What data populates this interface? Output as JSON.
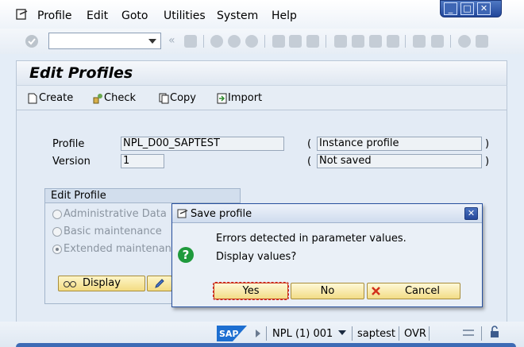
{
  "menu": {
    "items": [
      "Profile",
      "Edit",
      "Goto",
      "Utilities",
      "System",
      "Help"
    ],
    "underline": [
      "P",
      "E",
      "G",
      "U",
      "S",
      "H"
    ]
  },
  "window_controls": [
    "minimize",
    "maximize",
    "close"
  ],
  "toolbar": {
    "command_field_value": "",
    "icons": [
      "enter-icon",
      "save-icon",
      "back-icon",
      "exit-icon",
      "cancel-icon",
      "print-icon",
      "find-icon",
      "find-next-icon",
      "first-page-icon",
      "prev-page-icon",
      "next-page-icon",
      "last-page-icon",
      "new-session-icon",
      "shortcut-icon",
      "help-icon",
      "layout-icon"
    ]
  },
  "header": {
    "title": "Edit Profiles"
  },
  "app_toolbar": {
    "create": "Create",
    "check": "Check",
    "copy": "Copy",
    "import": "Import"
  },
  "form": {
    "profile_label": "Profile",
    "profile_value": "NPL_D00_SAPTEST",
    "profile_type": "Instance profile",
    "version_label": "Version",
    "version_value": "1",
    "version_status": "Not saved",
    "paren_open": "(",
    "paren_close": ")"
  },
  "group": {
    "title": "Edit Profile",
    "options": [
      "Administrative Data",
      "Basic maintenance",
      "Extended maintenance"
    ],
    "selected": "Extended maintenance",
    "display_button": "Display"
  },
  "dialog": {
    "title": "Save profile",
    "message_line1": "Errors detected in parameter values.",
    "message_line2": "Display values?",
    "yes": "Yes",
    "no": "No",
    "cancel": "Cancel"
  },
  "status": {
    "system": "NPL (1) 001",
    "user": "saptest",
    "mode": "OVR"
  },
  "colors": {
    "accent": "#2a55a5",
    "button": "#f3dc82"
  }
}
